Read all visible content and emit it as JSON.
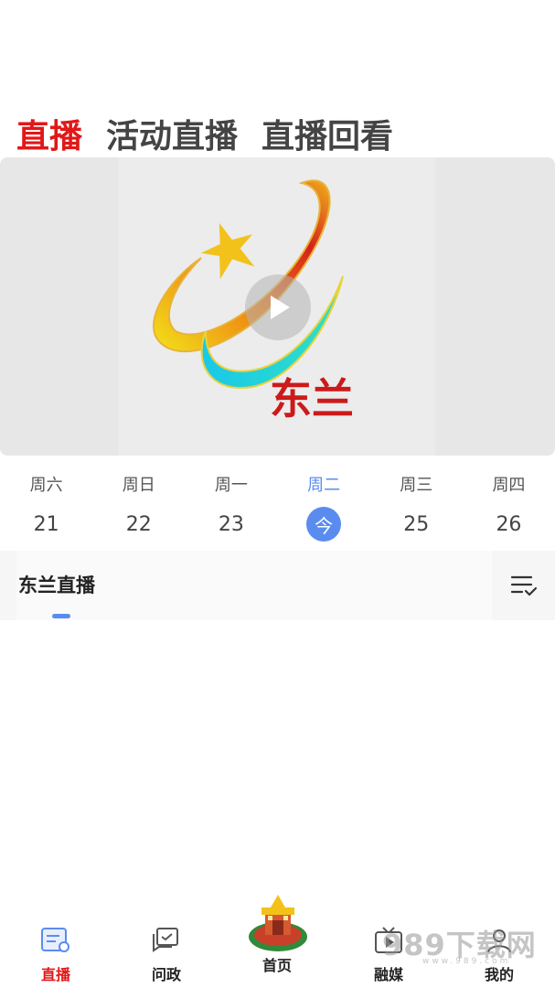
{
  "top_tabs": [
    {
      "label": "直播",
      "active": true
    },
    {
      "label": "活动直播",
      "active": false
    },
    {
      "label": "直播回看",
      "active": false
    }
  ],
  "player": {
    "logo_text": "东兰",
    "play_icon": "play-icon"
  },
  "dates": [
    {
      "weekday": "周六",
      "date": "21",
      "selected": false
    },
    {
      "weekday": "周日",
      "date": "22",
      "selected": false
    },
    {
      "weekday": "周一",
      "date": "23",
      "selected": false
    },
    {
      "weekday": "周二",
      "date": "今",
      "selected": true
    },
    {
      "weekday": "周三",
      "date": "25",
      "selected": false
    },
    {
      "weekday": "周四",
      "date": "26",
      "selected": false
    }
  ],
  "channel": {
    "tab_label": "东兰直播",
    "menu_icon": "list-check-icon"
  },
  "bottom_nav": [
    {
      "label": "直播",
      "icon": "live-icon",
      "active": true
    },
    {
      "label": "问政",
      "icon": "chat-icon",
      "active": false
    },
    {
      "label": "首页",
      "icon": "home-emblem-icon",
      "active": false
    },
    {
      "label": "融媒",
      "icon": "tv-icon",
      "active": false
    },
    {
      "label": "我的",
      "icon": "profile-icon",
      "active": false
    }
  ],
  "watermark": {
    "text": "989下载网",
    "sub": "www.989.com"
  },
  "colors": {
    "accent_red": "#e11818",
    "accent_blue": "#5a8cf0"
  }
}
